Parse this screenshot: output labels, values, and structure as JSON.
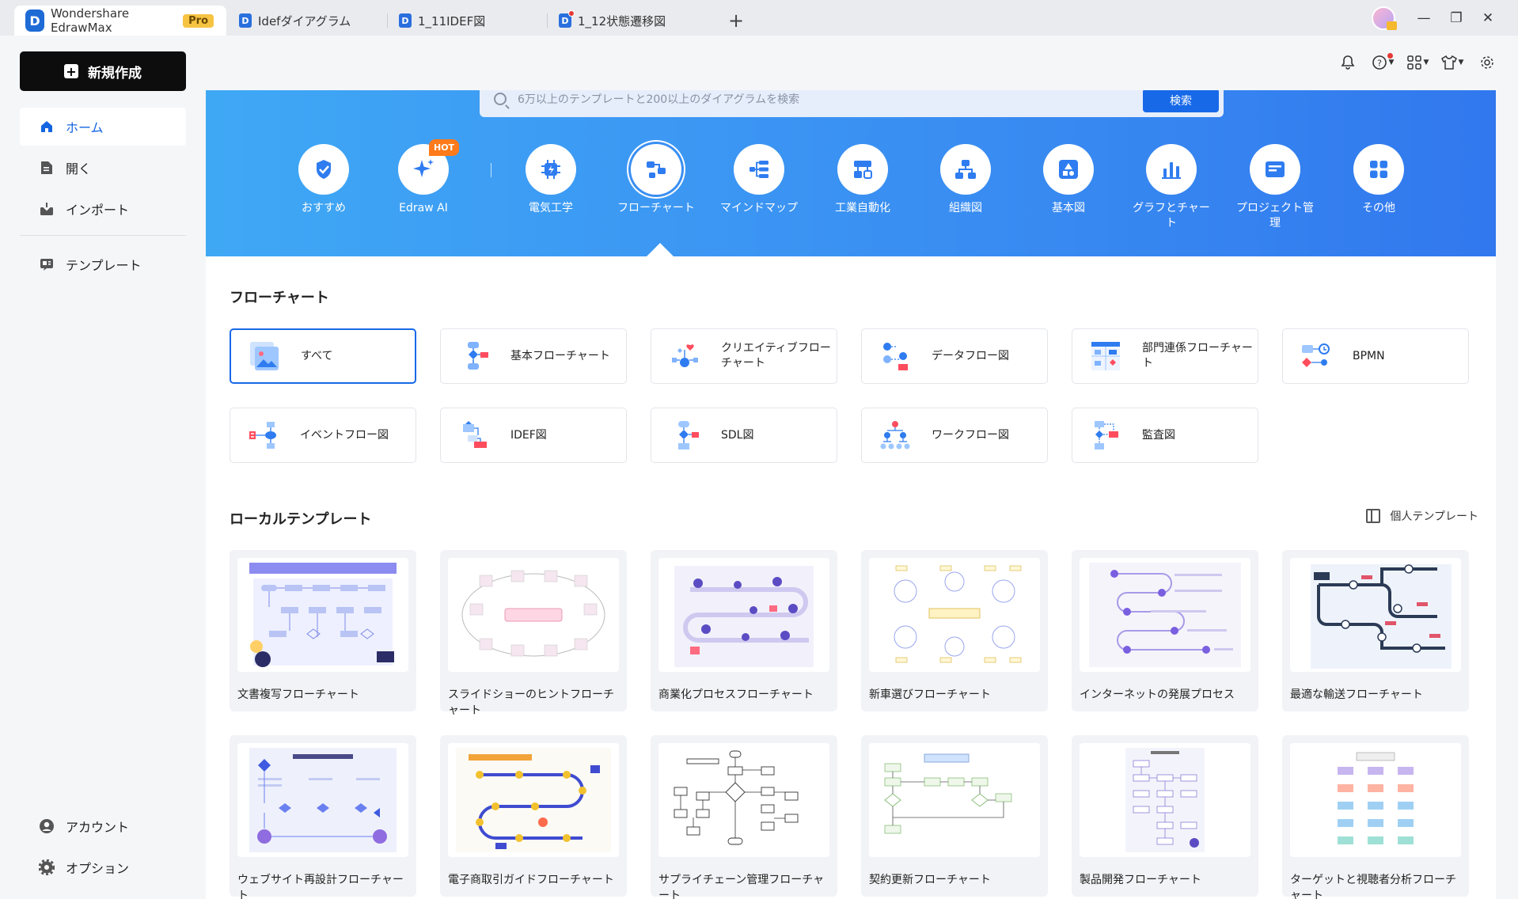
{
  "app": {
    "name": "Wondershare EdrawMax",
    "badge": "Pro"
  },
  "tabs": [
    {
      "label": "Idefダイアグラム"
    },
    {
      "label": "1_11IDEF図"
    },
    {
      "label": "1_12状態遷移図"
    }
  ],
  "sidebar": {
    "new_label": "新規作成",
    "items": [
      {
        "label": "ホーム",
        "icon": "home-icon"
      },
      {
        "label": "開く",
        "icon": "open-file-icon"
      },
      {
        "label": "インポート",
        "icon": "import-icon"
      },
      {
        "label": "テンプレート",
        "icon": "template-icon"
      }
    ],
    "bottom": [
      {
        "label": "アカウント",
        "icon": "account-icon"
      },
      {
        "label": "オプション",
        "icon": "options-gear-icon"
      }
    ]
  },
  "search": {
    "placeholder": "6万以上のテンプレートと200以上のダイアグラムを検索",
    "button": "検索"
  },
  "categories": [
    {
      "label": "おすすめ"
    },
    {
      "label": "Edraw AI",
      "badge": "HOT"
    },
    {
      "label": "電気工学"
    },
    {
      "label": "フローチャート"
    },
    {
      "label": "マインドマップ"
    },
    {
      "label": "工業自動化"
    },
    {
      "label": "組織図"
    },
    {
      "label": "基本図"
    },
    {
      "label": "グラフとチャート"
    },
    {
      "label": "プロジェクト管理"
    },
    {
      "label": "その他"
    }
  ],
  "flowchart_section": {
    "title": "フローチャート",
    "types": [
      {
        "label": "すべて"
      },
      {
        "label": "基本フローチャート"
      },
      {
        "label": "クリエイティブフローチャート"
      },
      {
        "label": "データフロー図"
      },
      {
        "label": "部門連係フローチャート"
      },
      {
        "label": "BPMN"
      },
      {
        "label": "イベントフロー図"
      },
      {
        "label": "IDEF図"
      },
      {
        "label": "SDL図"
      },
      {
        "label": "ワークフロー図"
      },
      {
        "label": "監査図"
      }
    ]
  },
  "local_templates": {
    "title": "ローカルテンプレート",
    "personal": "個人テンプレート",
    "items": [
      {
        "title": "文書複写フローチャート"
      },
      {
        "title": "スライドショーのヒントフローチャート"
      },
      {
        "title": "商業化プロセスフローチャート"
      },
      {
        "title": "新車選びフローチャート"
      },
      {
        "title": "インターネットの発展プロセス"
      },
      {
        "title": "最適な輸送フローチャート"
      },
      {
        "title": "ウェブサイト再設計フローチャート"
      },
      {
        "title": "電子商取引ガイドフローチャート"
      },
      {
        "title": "サプライチェーン管理フローチャート"
      },
      {
        "title": "契約更新フローチャート"
      },
      {
        "title": "製品開発フローチャート"
      },
      {
        "title": "ターゲットと視聴者分析フローチャート"
      }
    ]
  },
  "colors": {
    "accent": "#1769e8",
    "banner": "#3a8ff2",
    "hot": "#ff7a1a",
    "pro": "#f6c343"
  }
}
